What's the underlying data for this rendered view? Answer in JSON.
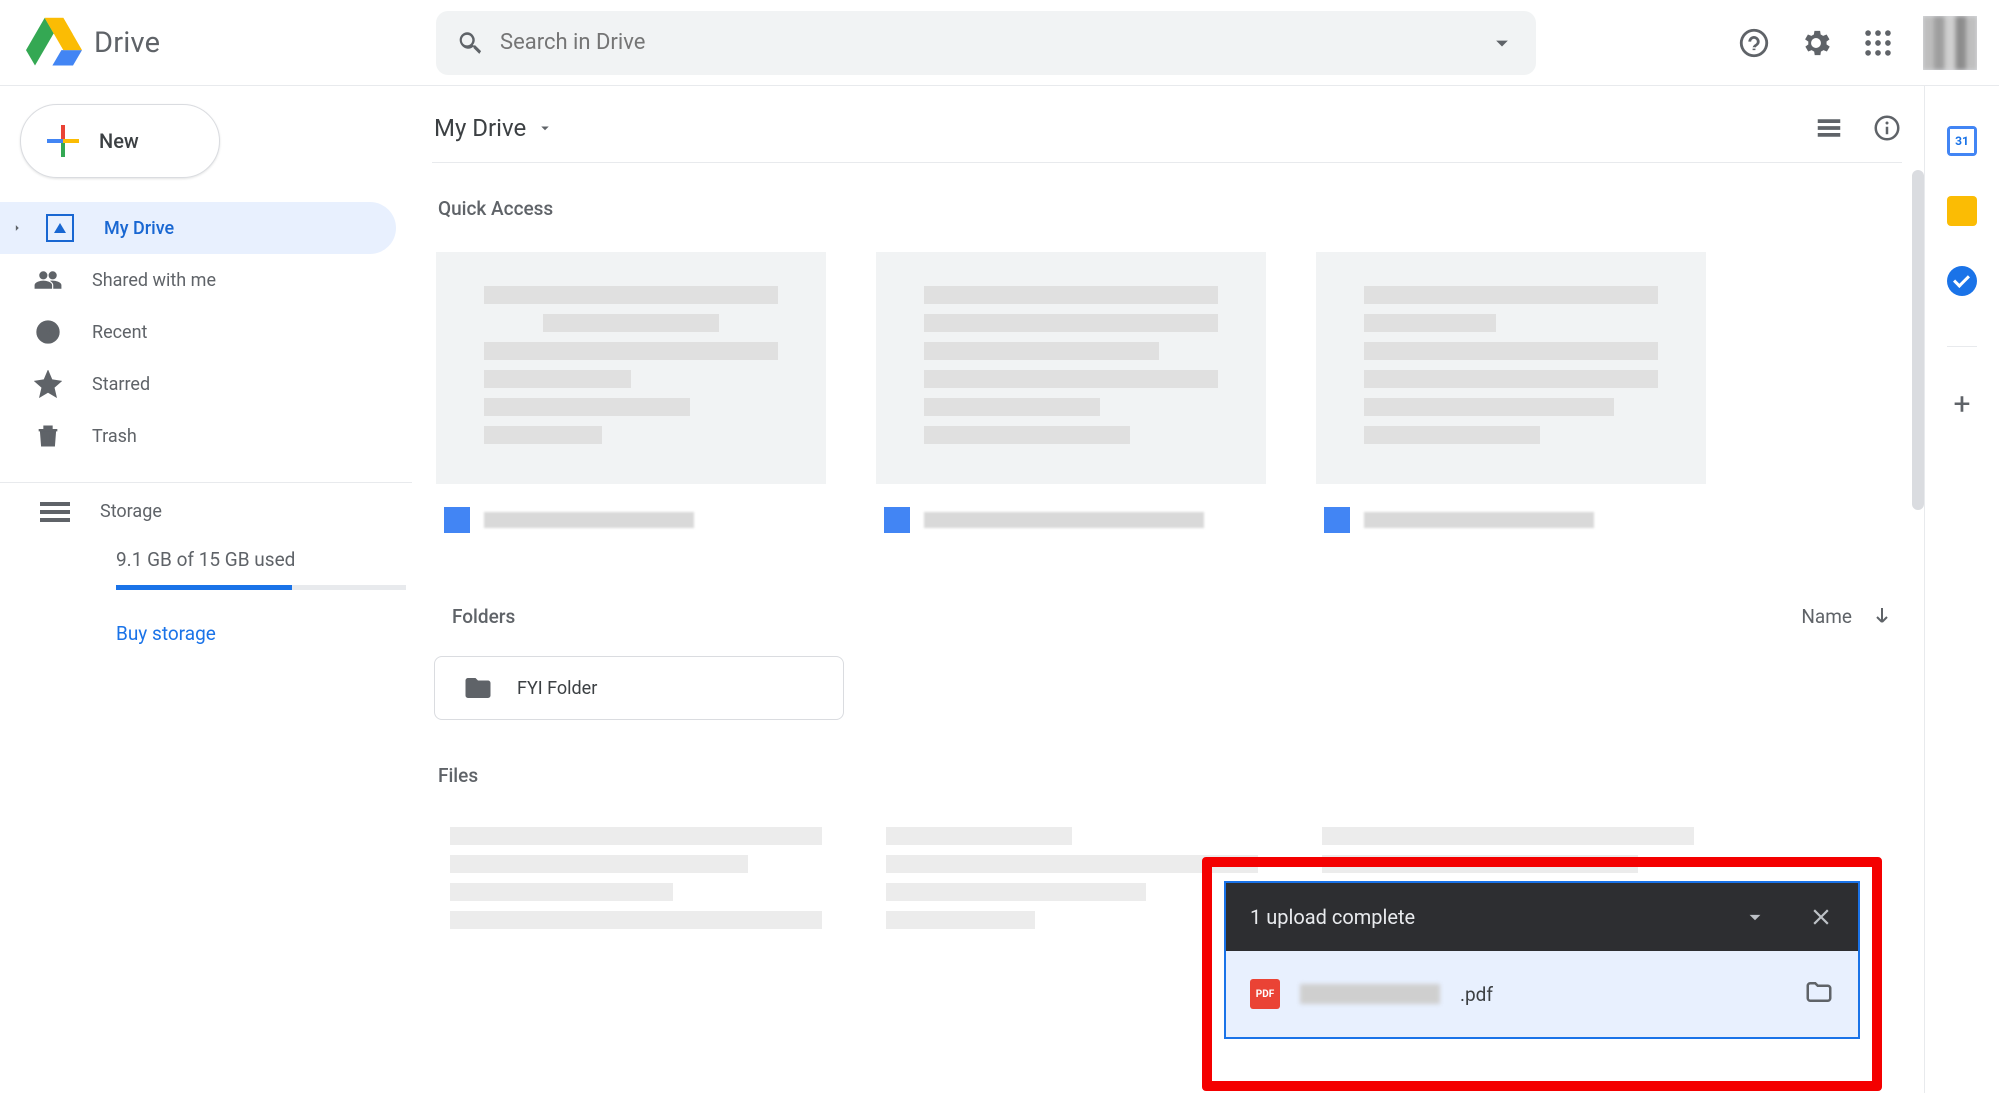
{
  "app": {
    "name": "Drive"
  },
  "search": {
    "placeholder": "Search in Drive"
  },
  "new_button": {
    "label": "New"
  },
  "nav": {
    "my_drive": "My Drive",
    "shared": "Shared with me",
    "recent": "Recent",
    "starred": "Starred",
    "trash": "Trash"
  },
  "storage": {
    "label": "Storage",
    "quota_text": "9.1 GB of 15 GB used",
    "used_gb": 9.1,
    "total_gb": 15,
    "buy_label": "Buy storage"
  },
  "breadcrumb": {
    "current": "My Drive"
  },
  "sections": {
    "quick_access": "Quick Access",
    "folders": "Folders",
    "files": "Files"
  },
  "sort": {
    "label": "Name"
  },
  "folders": [
    {
      "name": "FYI Folder"
    }
  ],
  "upload_toast": {
    "title": "1 upload complete",
    "file_ext": ".pdf"
  }
}
